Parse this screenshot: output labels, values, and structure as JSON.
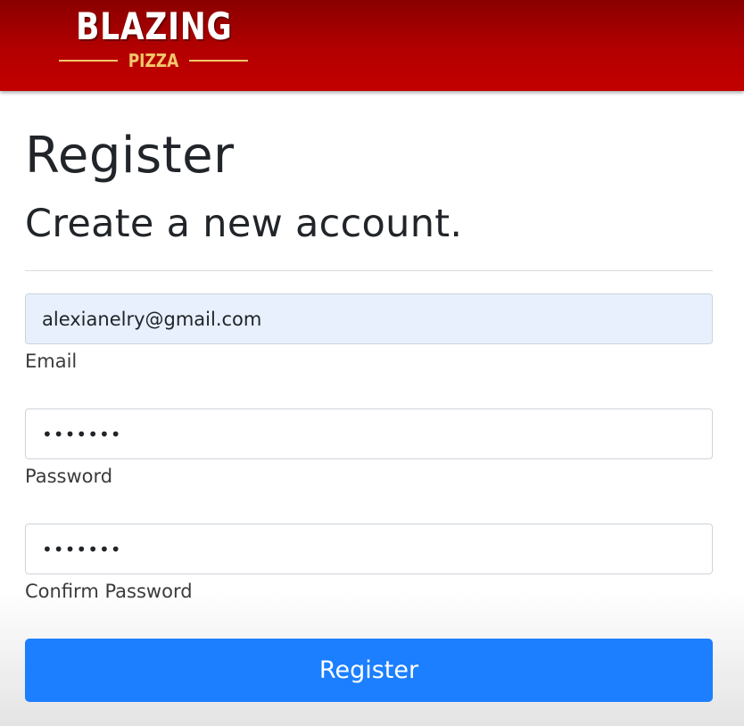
{
  "header": {
    "logo_main": "BLAZING",
    "logo_sub": "PIZZA"
  },
  "page": {
    "title": "Register",
    "subtitle": "Create a new account."
  },
  "form": {
    "email": {
      "value": "alexianelry@gmail.com",
      "label": "Email"
    },
    "password": {
      "value": "•••••••",
      "label": "Password"
    },
    "confirm_password": {
      "value": "•••••••",
      "label": "Confirm Password"
    },
    "submit_label": "Register"
  },
  "colors": {
    "header_red": "#b30000",
    "logo_gold": "#f2c66b",
    "button_blue": "#1b7fff",
    "autofill_bg": "#e8f0fe"
  }
}
